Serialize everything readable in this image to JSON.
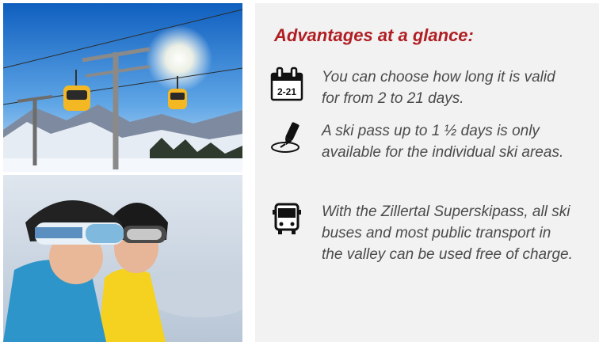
{
  "heading": "Advantages at a glance:",
  "calendar_icon_label": "2-21",
  "items": [
    {
      "icon": "calendar-icon",
      "text": "You can choose how long it is valid for from 2 to 21 days."
    },
    {
      "icon": "ski-pass-pen-icon",
      "text": "A ski pass up to 1 ½ days is only available for the individual ski areas."
    },
    {
      "icon": "ski-bus-icon",
      "text": "With the Zillertal Superskipass, all ski buses and most public transport in the valley can be used free of charge."
    }
  ],
  "colors": {
    "accent": "#b01e23",
    "text": "#4a4a4a",
    "panel": "#f2f2f2"
  }
}
